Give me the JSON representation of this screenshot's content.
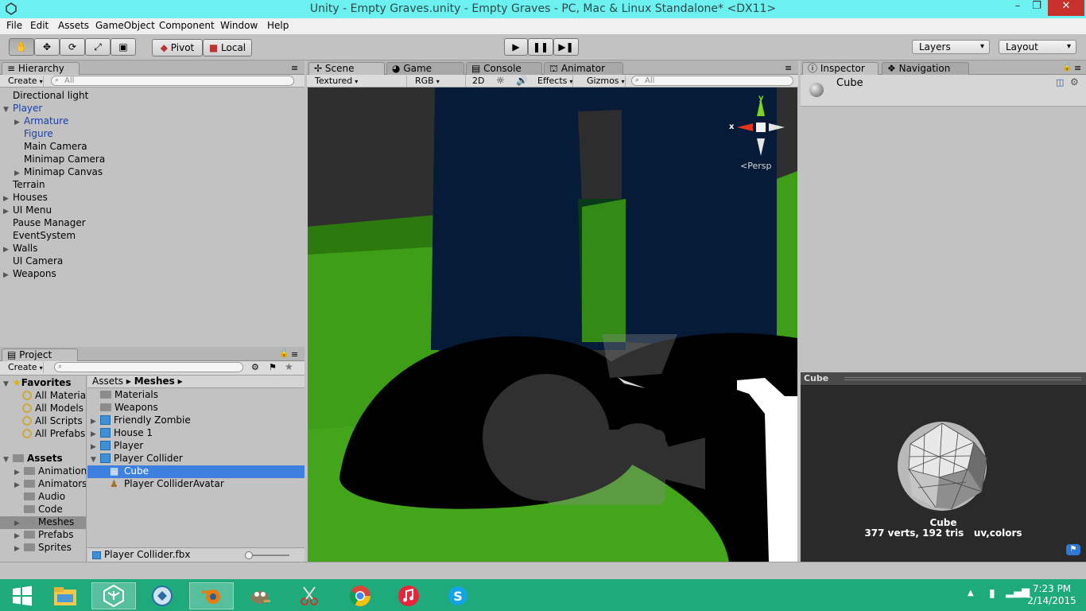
{
  "window": {
    "title": "Unity - Empty Graves.unity - Empty Graves - PC, Mac & Linux Standalone* <DX11>"
  },
  "menu": [
    "File",
    "Edit",
    "Assets",
    "GameObject",
    "Component",
    "Window",
    "Help"
  ],
  "toolbar": {
    "pivot": "Pivot",
    "local": "Local",
    "layers": "Layers",
    "layout": "Layout"
  },
  "hierarchy": {
    "tab": "Hierarchy",
    "create": "Create",
    "search_placeholder": "All",
    "items": [
      {
        "label": "Directional light"
      },
      {
        "label": "Player"
      },
      {
        "label": "Armature"
      },
      {
        "label": "Figure"
      },
      {
        "label": "Main Camera"
      },
      {
        "label": "Minimap Camera"
      },
      {
        "label": "Minimap Canvas"
      },
      {
        "label": "Terrain"
      },
      {
        "label": "Houses"
      },
      {
        "label": "UI Menu"
      },
      {
        "label": "Pause Manager"
      },
      {
        "label": "EventSystem"
      },
      {
        "label": "Walls"
      },
      {
        "label": "UI Camera"
      },
      {
        "label": "Weapons"
      }
    ]
  },
  "scene": {
    "tabs": [
      "Scene",
      "Game",
      "Console",
      "Animator"
    ],
    "shading": "Textured",
    "render": "RGB",
    "mode2d": "2D",
    "effects": "Effects",
    "gizmos": "Gizmos",
    "search_placeholder": "All",
    "persp": "Persp",
    "axis_x": "x",
    "axis_y": "y"
  },
  "inspector": {
    "tabs": [
      "Inspector",
      "Navigation"
    ],
    "object": "Cube"
  },
  "preview": {
    "header": "Cube",
    "name": "Cube",
    "stats": "377 verts, 192 tris   uv,colors"
  },
  "project": {
    "tab": "Project",
    "create": "Create",
    "favorites_label": "Favorites",
    "favorites": [
      "All Material",
      "All Models",
      "All Scripts",
      "All Prefabs"
    ],
    "assets_label": "Assets",
    "asset_folders": [
      "Animations",
      "Animators",
      "Audio",
      "Code",
      "Meshes",
      "Prefabs",
      "Sprites"
    ],
    "breadcrumb": [
      "Assets",
      "Meshes"
    ],
    "files": [
      {
        "label": "Materials"
      },
      {
        "label": "Weapons"
      },
      {
        "label": "Friendly Zombie"
      },
      {
        "label": "House 1"
      },
      {
        "label": "Player"
      },
      {
        "label": "Player Collider"
      },
      {
        "label": "Cube"
      },
      {
        "label": "Player ColliderAvatar"
      }
    ],
    "footer_file": "Player Collider.fbx"
  },
  "taskbar": {
    "time": "7:23 PM",
    "date": "2/14/2015"
  },
  "colors": {
    "titlebar": "#6df0f0",
    "taskbar": "#1faa7c",
    "selection": "#3d80df",
    "grass": "#3f9f17",
    "night": "#061e3a"
  }
}
